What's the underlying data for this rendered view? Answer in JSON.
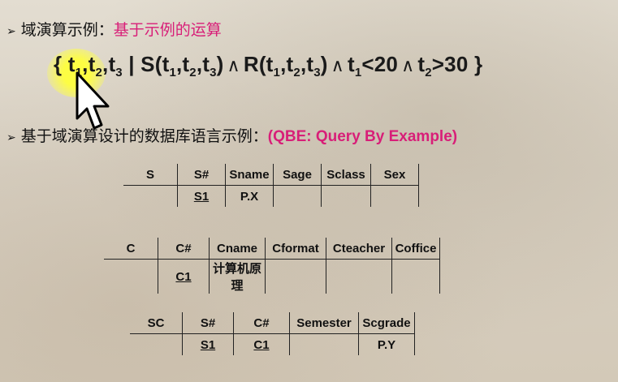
{
  "slide": {
    "line1": {
      "label": "域演算示例：",
      "accent": "基于示例的运算"
    },
    "formula": {
      "open": "{ ",
      "t1": "t",
      "s1": "1",
      "t2": "t",
      "s2": "2",
      "t3": "t",
      "s3": "3",
      "bar": " | ",
      "S": "S(t",
      "Ssub1": "1",
      "Sc1": ",t",
      "Ssub2": "2",
      "Sc2": ",t",
      "Ssub3": "3",
      "Sclose": ")",
      "and": "∧",
      "R": "R(t",
      "Rsub1": "1",
      "Rc1": ",t",
      "Rsub2": "2",
      "Rc2": ",t",
      "Rsub3": "3",
      "Rclose": ")",
      "c1": "t",
      "c1sub": "1",
      "c1op": "<20",
      "c2": "t",
      "c2sub": "2",
      "c2op": ">30",
      "close": " }"
    },
    "line2": {
      "label": "基于域演算设计的数据库语言示例：",
      "accent": "(QBE: Query By Example)"
    },
    "tables": [
      {
        "headers": [
          "S",
          "S#",
          "Sname",
          "Sage",
          "Sclass",
          "Sex"
        ],
        "row": [
          "",
          "S1",
          "P.X",
          "",
          "",
          ""
        ]
      },
      {
        "headers": [
          "C",
          "C#",
          "Cname",
          "Cformat",
          "Cteacher",
          "Coffice"
        ],
        "row": [
          "",
          "C1",
          "计算机原理",
          "",
          "",
          ""
        ]
      },
      {
        "headers": [
          "SC",
          "S#",
          "C#",
          "Semester",
          "Scgrade"
        ],
        "row": [
          "",
          "S1",
          "C1",
          "",
          "P.Y"
        ]
      }
    ]
  },
  "colors": {
    "accent": "#d81e78",
    "highlight": "#ffff3c"
  },
  "icons": [
    "arrow-bullet-icon",
    "mouse-pointer-icon"
  ]
}
